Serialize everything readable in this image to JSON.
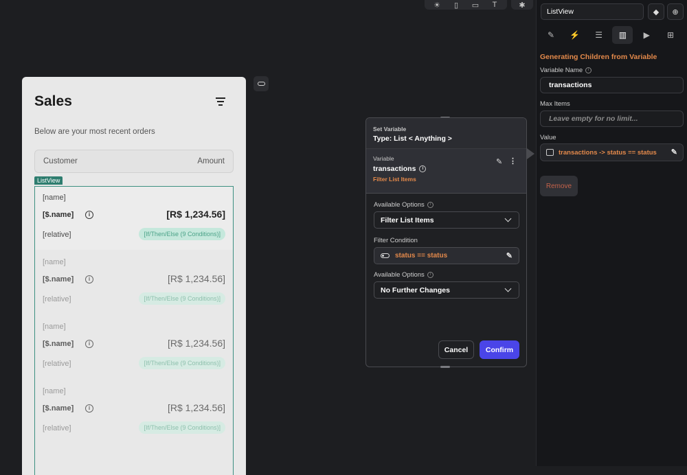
{
  "toolbar": {
    "icons": [
      "sun-icon",
      "phone-icon",
      "tablet-icon",
      "text-size-icon",
      "bug-icon"
    ]
  },
  "phone": {
    "title": "Sales",
    "subtitle": "Below are your most recent orders",
    "header": {
      "customer": "Customer",
      "amount": "Amount"
    },
    "listview_tag": "ListView",
    "rows": [
      {
        "name": "[name]",
        "sname": "[$.name]",
        "amount": "[R$ 1,234.56]",
        "relative": "[relative]",
        "condition": "[If/Then/Else (9 Conditions)]"
      },
      {
        "name": "[name]",
        "sname": "[$.name]",
        "amount": "[R$ 1,234.56]",
        "relative": "[relative]",
        "condition": "[If/Then/Else (9 Conditions)]"
      },
      {
        "name": "[name]",
        "sname": "[$.name]",
        "amount": "[R$ 1,234.56]",
        "relative": "[relative]",
        "condition": "[If/Then/Else (9 Conditions)]"
      },
      {
        "name": "[name]",
        "sname": "[$.name]",
        "amount": "[R$ 1,234.56]",
        "relative": "[relative]",
        "condition": "[If/Then/Else (9 Conditions)]"
      }
    ]
  },
  "modal": {
    "heading": "Set Variable",
    "type": "Type: List < Anything >",
    "variable_label": "Variable",
    "variable_name": "transactions",
    "variable_filter": "Filter List Items",
    "available_options_label": "Available Options",
    "option1_value": "Filter List Items",
    "filter_condition_label": "Filter Condition",
    "filter_condition_value": "status  ==  status",
    "available_options_label2": "Available Options",
    "option2_value": "No Further Changes",
    "cancel": "Cancel",
    "confirm": "Confirm"
  },
  "panel": {
    "widget_name": "ListView",
    "section_title": "Generating Children from Variable",
    "variable_name_label": "Variable Name",
    "variable_name_value": "transactions",
    "max_items_label": "Max Items",
    "max_items_placeholder": "Leave empty for no limit...",
    "value_label": "Value",
    "value_text": "transactions -> status  ==  status",
    "remove": "Remove"
  },
  "colors": {
    "accent_orange": "#e58a4b",
    "confirm_blue": "#4a45e8",
    "listview_green": "#2e7d6f"
  }
}
